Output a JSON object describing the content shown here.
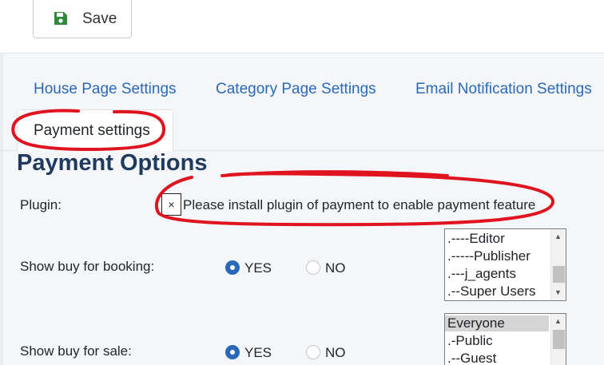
{
  "toolbar": {
    "save_label": "Save",
    "save_icon": "floppy-disk-icon"
  },
  "tabs": [
    {
      "label": "House Page Settings"
    },
    {
      "label": "Category Page Settings"
    },
    {
      "label": "Email Notification Settings"
    },
    {
      "label": "Payment settings",
      "active": true
    }
  ],
  "section": {
    "title": "Payment Options"
  },
  "plugin": {
    "label": "Plugin:",
    "close_glyph": "×",
    "notice": "Please install plugin of payment to enable payment feature"
  },
  "booking": {
    "label": "Show buy for booking:",
    "options": [
      {
        "label": "YES",
        "selected": true
      },
      {
        "label": "NO",
        "selected": false
      }
    ],
    "groups": [
      ".----Editor",
      ".-----Publisher",
      ".---j_agents",
      ".--Super Users"
    ]
  },
  "sale": {
    "label": "Show buy for sale:",
    "options": [
      {
        "label": "YES",
        "selected": true
      },
      {
        "label": "NO",
        "selected": false
      }
    ],
    "groups": [
      "Everyone",
      ".-Public",
      ".--Guest"
    ],
    "selected_group": "Everyone"
  },
  "colors": {
    "accent": "#2a69b8",
    "annotation": "#e0141e",
    "title": "#1f3a5c"
  }
}
